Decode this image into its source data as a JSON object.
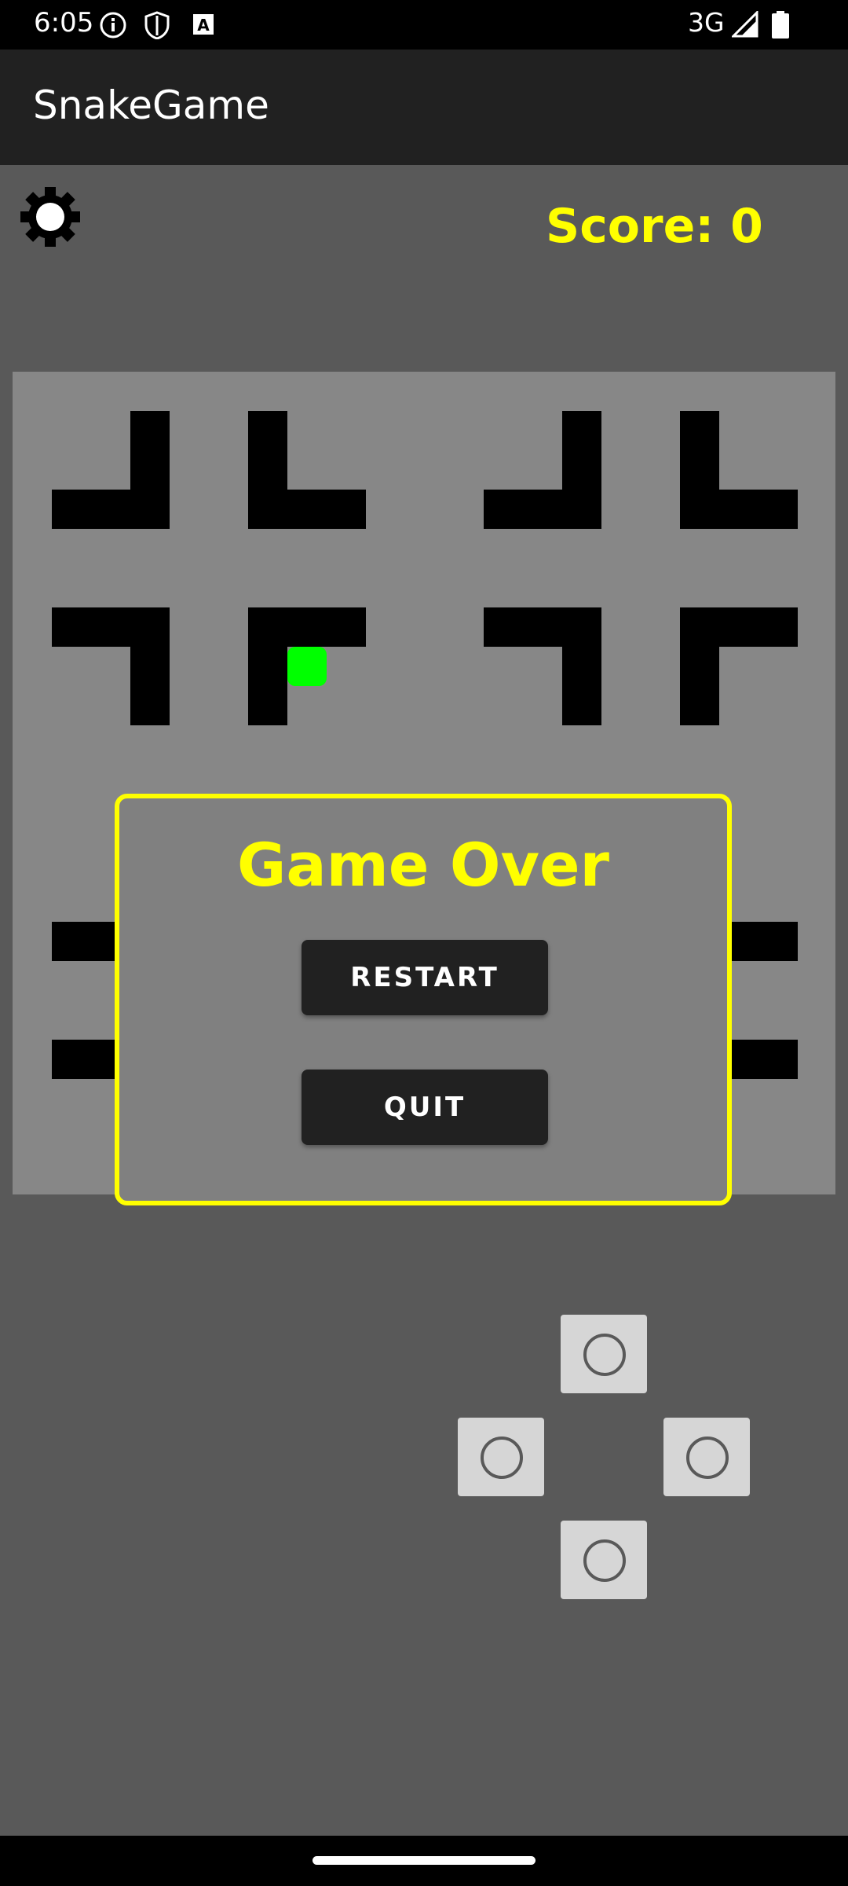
{
  "status_bar": {
    "time": "6:05",
    "network": "3G",
    "icons": [
      "info-icon",
      "shield-icon",
      "a-icon",
      "signal-icon",
      "battery-icon"
    ]
  },
  "app_bar": {
    "title": "SnakeGame"
  },
  "game": {
    "score_text": "Score: 0",
    "score_color": "#ffff00",
    "snake_food_color": "#00ff00",
    "board_color": "#878787",
    "wall_color": "#000000"
  },
  "dialog": {
    "title": "Game Over",
    "restart_label": "RESTART",
    "quit_label": "QUIT",
    "border_color": "#ffff00"
  },
  "controls": {
    "icons": [
      "dpad-up-button",
      "dpad-left-button",
      "dpad-right-button",
      "dpad-down-button"
    ]
  }
}
